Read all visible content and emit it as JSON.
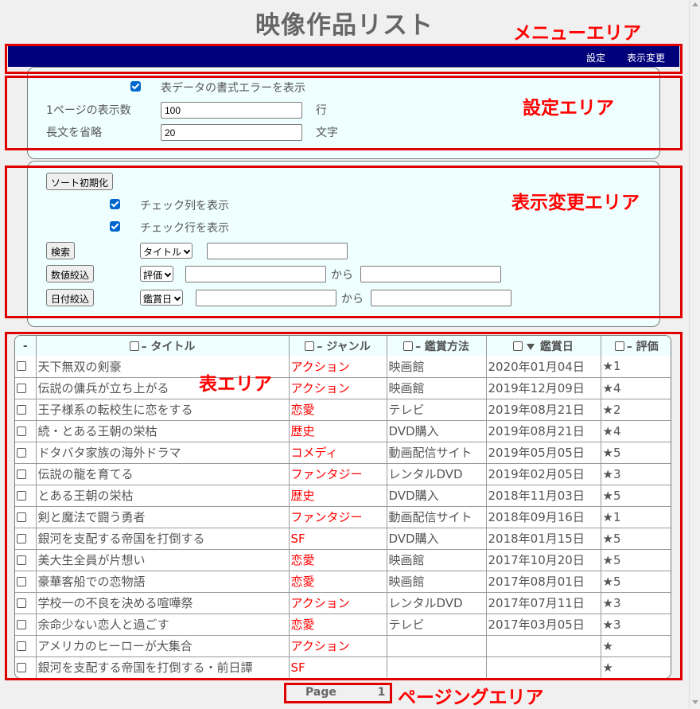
{
  "page_title": "映像作品リスト",
  "annotations": {
    "menu_area": "メニューエリア",
    "settings_area": "設定エリア",
    "display_area": "表示変更エリア",
    "table_area": "表エリア",
    "paging_area": "ページングエリア"
  },
  "menu": {
    "settings": "設定",
    "display_change": "表示変更"
  },
  "settings": {
    "show_format_errors_label": "表データの書式エラーを表示",
    "show_format_errors_checked": true,
    "rows_per_page_label": "1ページの表示数",
    "rows_per_page_value": "100",
    "rows_per_page_unit": "行",
    "truncate_label": "長文を省略",
    "truncate_value": "20",
    "truncate_unit": "文字"
  },
  "display": {
    "reset_sort": "ソート初期化",
    "show_check_column": "チェック列を表示",
    "show_check_row": "チェック行を表示",
    "search_button": "検索",
    "search_field": "タイトル",
    "search_value": "",
    "numeric_filter_button": "数値絞込",
    "numeric_field": "評価",
    "numeric_from": "",
    "numeric_from_label": "から",
    "numeric_to": "",
    "date_filter_button": "日付絞込",
    "date_field": "鑑賞日",
    "date_from": "",
    "date_from_label": "から",
    "date_to": ""
  },
  "table": {
    "corner": "-",
    "headers": {
      "title": "– タイトル",
      "genre": "– ジャンル",
      "method": "– 鑑賞方法",
      "date": "鑑賞日",
      "rating": "– 評価"
    },
    "rows": [
      {
        "title": "天下無双の剣豪",
        "genre": "アクション",
        "method": "映画館",
        "date": "2020年01月04日",
        "rating": "★1"
      },
      {
        "title": "伝説の傭兵が立ち上がる",
        "genre": "アクション",
        "method": "映画館",
        "date": "2019年12月09日",
        "rating": "★4"
      },
      {
        "title": "王子様系の転校生に恋をする",
        "genre": "恋愛",
        "method": "テレビ",
        "date": "2019年08月21日",
        "rating": "★2"
      },
      {
        "title": "続・とある王朝の栄枯",
        "genre": "歴史",
        "method": "DVD購入",
        "date": "2019年08月21日",
        "rating": "★4"
      },
      {
        "title": "ドタバタ家族の海外ドラマ",
        "genre": "コメディ",
        "method": "動画配信サイト",
        "date": "2019年05月05日",
        "rating": "★5"
      },
      {
        "title": "伝説の龍を育てる",
        "genre": "ファンタジー",
        "method": "レンタルDVD",
        "date": "2019年02月05日",
        "rating": "★3"
      },
      {
        "title": "とある王朝の栄枯",
        "genre": "歴史",
        "method": "DVD購入",
        "date": "2018年11月03日",
        "rating": "★5"
      },
      {
        "title": "剣と魔法で闘う勇者",
        "genre": "ファンタジー",
        "method": "動画配信サイト",
        "date": "2018年09月16日",
        "rating": "★1"
      },
      {
        "title": "銀河を支配する帝国を打倒する",
        "genre": "SF",
        "method": "DVD購入",
        "date": "2018年01月15日",
        "rating": "★5"
      },
      {
        "title": "美大生全員が片想い",
        "genre": "恋愛",
        "method": "映画館",
        "date": "2017年10月20日",
        "rating": "★5"
      },
      {
        "title": "豪華客船での恋物語",
        "genre": "恋愛",
        "method": "映画館",
        "date": "2017年08月01日",
        "rating": "★5"
      },
      {
        "title": "学校一の不良を決める喧嘩祭",
        "genre": "アクション",
        "method": "レンタルDVD",
        "date": "2017年07月11日",
        "rating": "★3"
      },
      {
        "title": "余命少ない恋人と過ごす",
        "genre": "恋愛",
        "method": "テレビ",
        "date": "2017年03月05日",
        "rating": "★3"
      },
      {
        "title": "アメリカのヒーローが大集合",
        "genre": "アクション",
        "method": "",
        "date": "",
        "rating": "★"
      },
      {
        "title": "銀河を支配する帝国を打倒する・前日譚",
        "genre": "SF",
        "method": "",
        "date": "",
        "rating": "★"
      }
    ]
  },
  "pager": {
    "label": "Page",
    "number": "1"
  },
  "colors": {
    "menu_bg": "#00007a",
    "panel_bg": "#efffff",
    "annotation": "#ff0000",
    "genre_text": "#ff0000",
    "checkbox_accent": "#0066cc"
  }
}
